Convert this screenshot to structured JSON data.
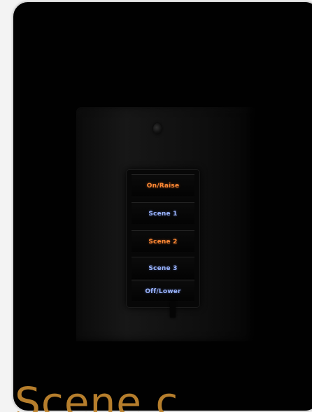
{
  "keypad": {
    "buttons": [
      {
        "label": "On/Raise"
      },
      {
        "label": "Scene 1"
      },
      {
        "label": "Scene 2"
      },
      {
        "label": "Scene 3"
      },
      {
        "label": "Off/Lower"
      }
    ]
  },
  "bottom_text": "e Scene c",
  "colors": {
    "background": "#010101",
    "orange_label": "#ff8a35",
    "blue_label": "#9bb5ff",
    "bottom_text": "#c0852f"
  }
}
